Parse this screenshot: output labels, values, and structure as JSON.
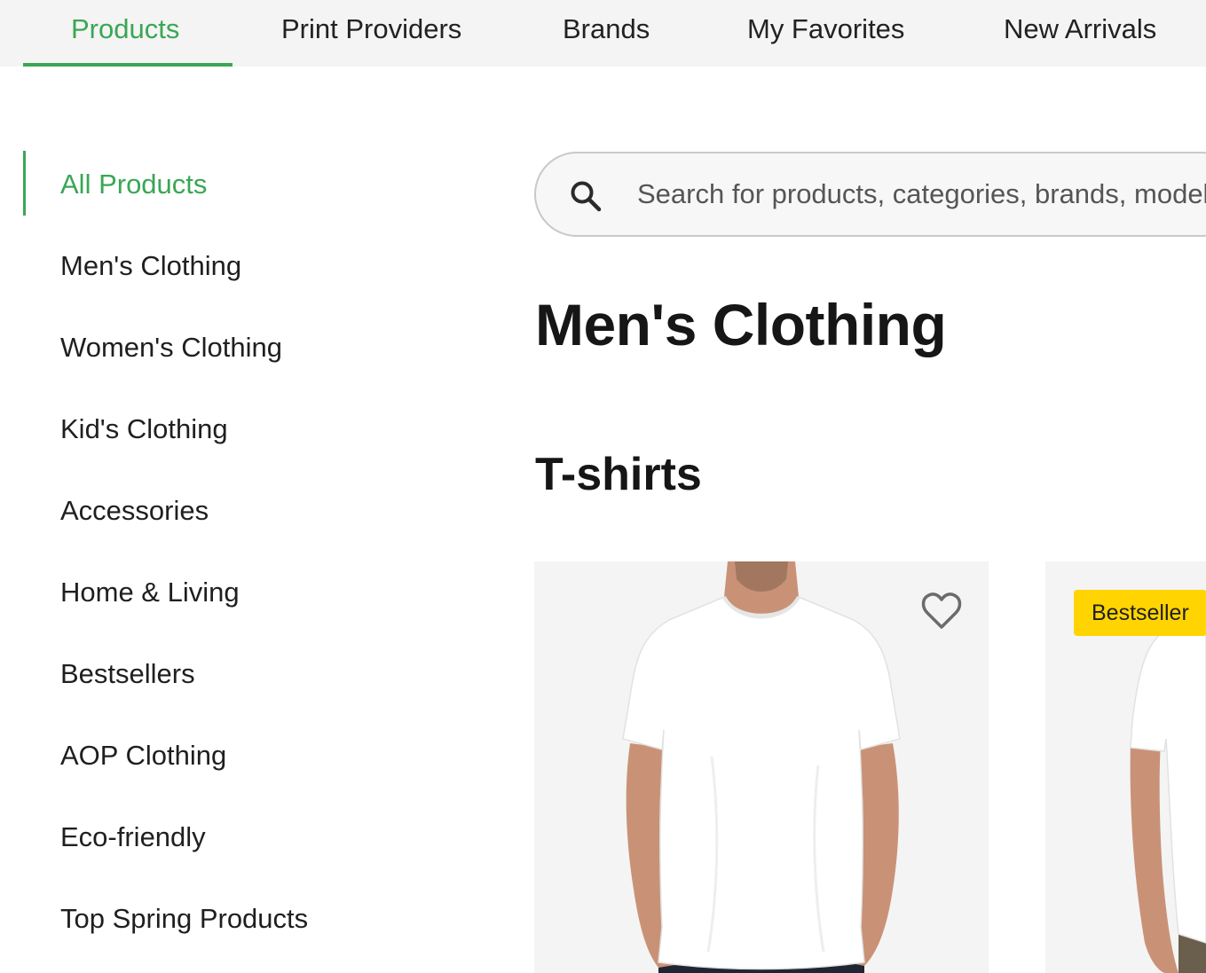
{
  "topnav": {
    "tabs": [
      {
        "label": "Products",
        "active": true
      },
      {
        "label": "Print Providers",
        "active": false
      },
      {
        "label": "Brands",
        "active": false
      },
      {
        "label": "My Favorites",
        "active": false
      },
      {
        "label": "New Arrivals",
        "active": false
      }
    ]
  },
  "sidebar": {
    "items": [
      {
        "label": "All Products",
        "active": true
      },
      {
        "label": "Men's Clothing"
      },
      {
        "label": "Women's Clothing"
      },
      {
        "label": "Kid's Clothing"
      },
      {
        "label": "Accessories"
      },
      {
        "label": "Home & Living"
      },
      {
        "label": "Bestsellers"
      },
      {
        "label": "AOP Clothing"
      },
      {
        "label": "Eco-friendly"
      },
      {
        "label": "Top Spring Products"
      }
    ]
  },
  "search": {
    "placeholder": "Search for products, categories, brands, models"
  },
  "main": {
    "page_title": "Men's Clothing",
    "section_title": "T-shirts",
    "products": [
      {
        "badge": "",
        "favorite_icon": "heart-outline-icon"
      },
      {
        "badge": "Bestseller"
      }
    ]
  },
  "colors": {
    "accent": "#3aa655",
    "badge": "#ffd400",
    "nav_bg": "#f4f4f4",
    "card_bg": "#f4f4f4"
  }
}
